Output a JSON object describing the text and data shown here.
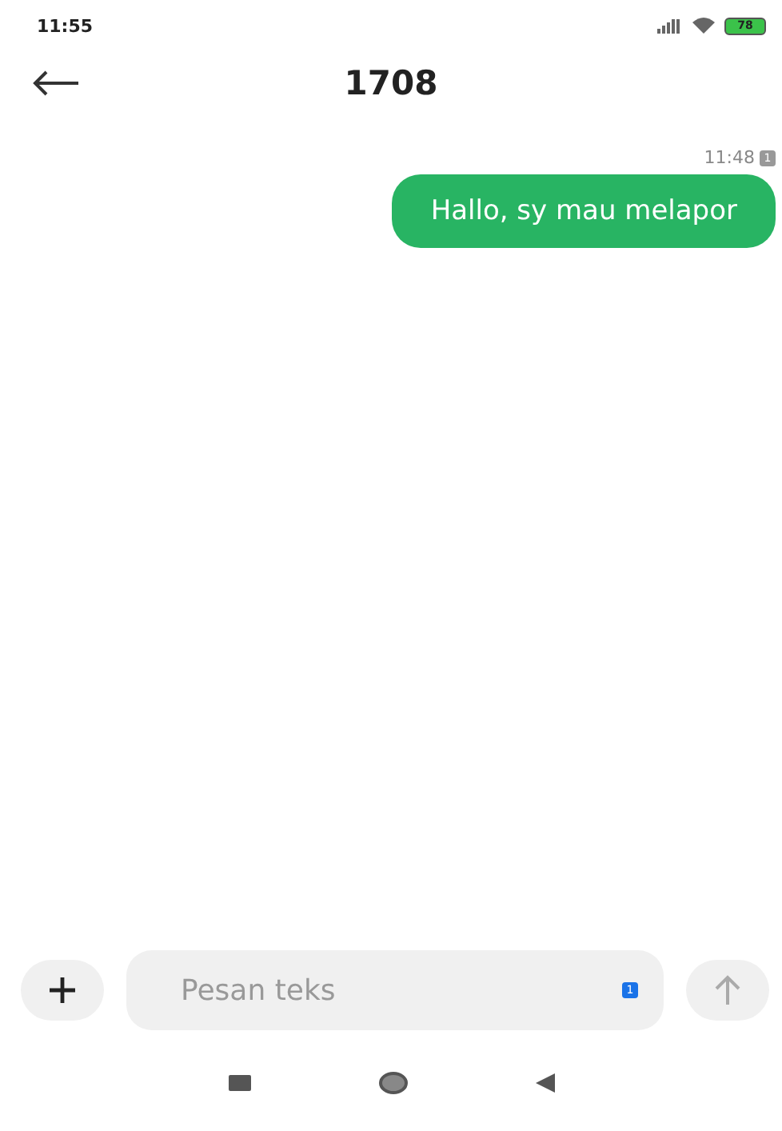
{
  "status_bar": {
    "time": "11:55",
    "battery": "78"
  },
  "header": {
    "title": "1708"
  },
  "messages": [
    {
      "time": "11:48",
      "sim": "1",
      "text": "Hallo, sy mau melapor",
      "outgoing": true
    }
  ],
  "composer": {
    "placeholder": "Pesan teks",
    "sim": "1"
  }
}
